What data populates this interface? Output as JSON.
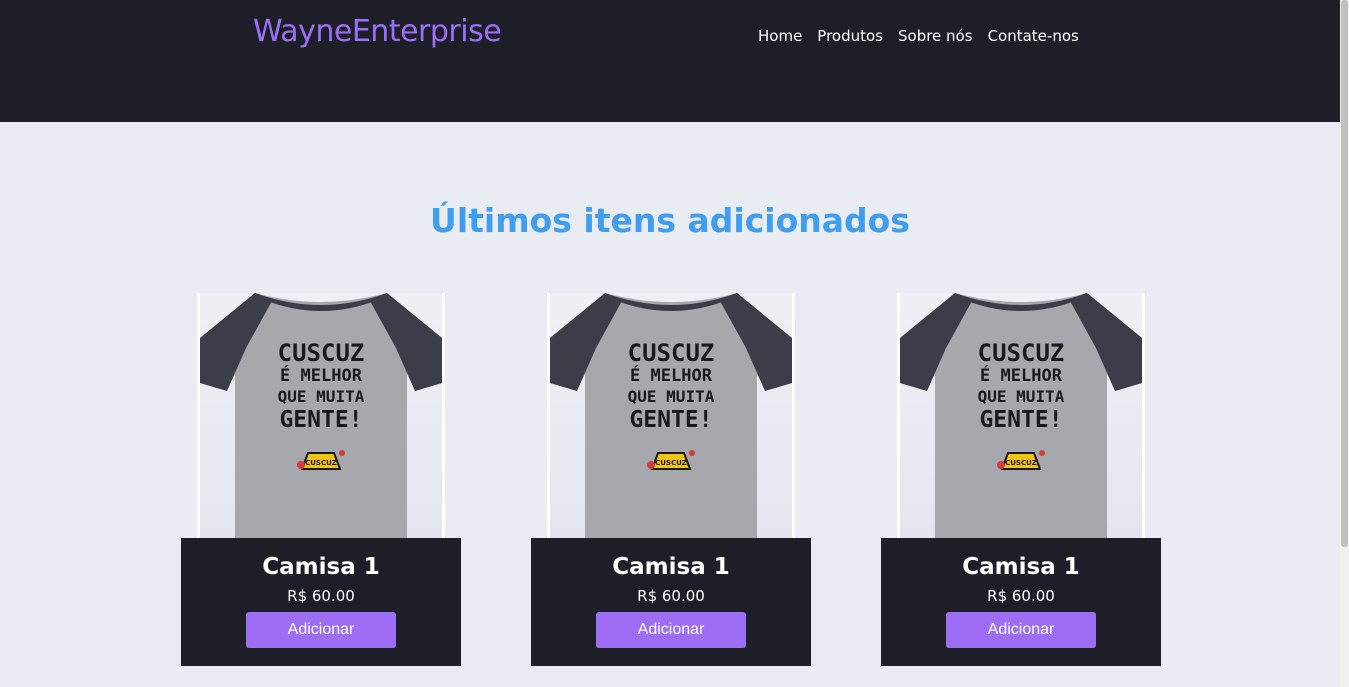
{
  "header": {
    "brand": "WayneEnterprise",
    "nav": [
      "Home",
      "Produtos",
      "Sobre nós",
      "Contate-nos"
    ]
  },
  "main": {
    "title": "Últimos itens adicionados",
    "products": [
      {
        "name": "Camisa 1",
        "price": "R$ 60.00",
        "button": "Adicionar",
        "shirt_text": [
          "CUSCUZ",
          "É MELHOR",
          "QUE MUITA",
          "GENTE!"
        ],
        "pot_label": "CUSCUZ"
      },
      {
        "name": "Camisa 1",
        "price": "R$ 60.00",
        "button": "Adicionar",
        "shirt_text": [
          "CUSCUZ",
          "É MELHOR",
          "QUE MUITA",
          "GENTE!"
        ],
        "pot_label": "CUSCUZ"
      },
      {
        "name": "Camisa 1",
        "price": "R$ 60.00",
        "button": "Adicionar",
        "shirt_text": [
          "CUSCUZ",
          "É MELHOR",
          "QUE MUITA",
          "GENTE!"
        ],
        "pot_label": "CUSCUZ"
      }
    ]
  },
  "colors": {
    "header_bg": "#1c1f28",
    "brand": "#9d6ef5",
    "title": "#3f9df2",
    "button": "#9d6ef5",
    "page_bg": "#e9ecf3"
  }
}
